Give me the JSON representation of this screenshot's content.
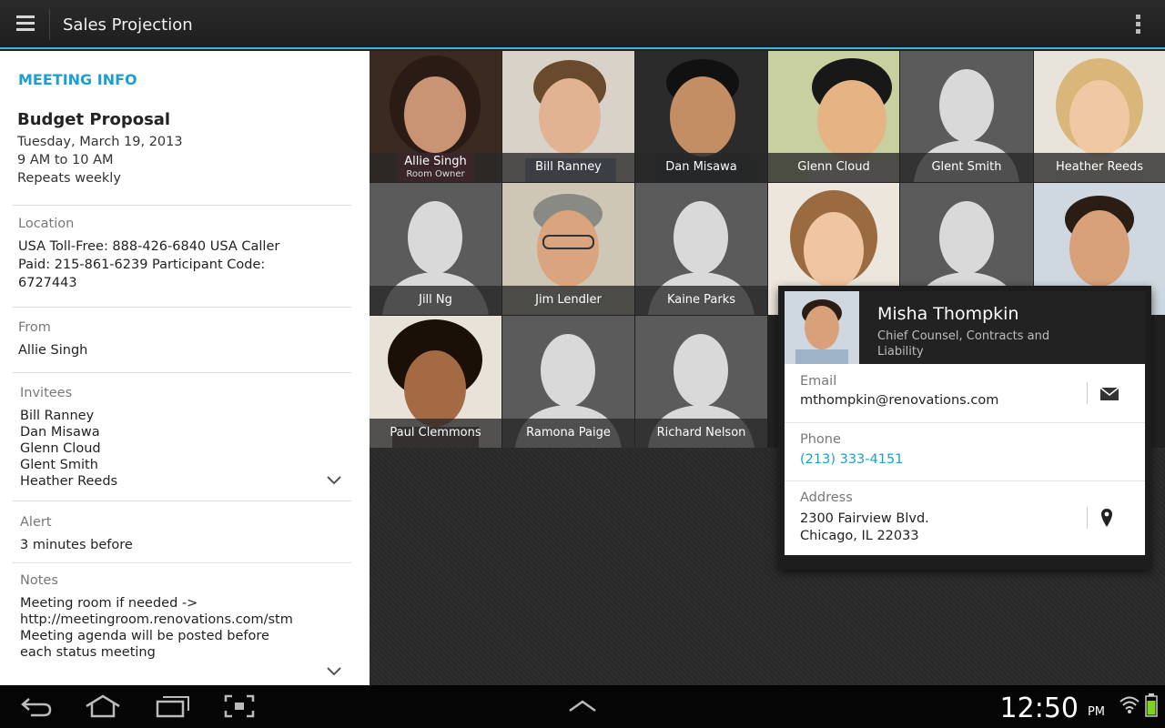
{
  "app": {
    "title": "Sales Projection"
  },
  "meeting": {
    "header": "MEETING INFO",
    "title": "Budget Proposal",
    "date": "Tuesday, March 19, 2013",
    "time": "9 AM to 10 AM",
    "repeat": "Repeats weekly",
    "location_label": "Location",
    "location_value": "USA Toll-Free: 888-426-6840 USA Caller Paid: 215-861-6239 Participant Code: 6727443",
    "from_label": "From",
    "from_value": "Allie Singh",
    "invitees_label": "Invitees",
    "invitees": [
      "Bill Ranney",
      "Dan Misawa",
      "Glenn Cloud",
      "Glent Smith",
      "Heather Reeds"
    ],
    "alert_label": "Alert",
    "alert_value": "3 minutes before",
    "notes_label": "Notes",
    "notes_value": "Meeting room if needed -> http://meetingroom.renovations.com/stmeetings/room/alliesingh@renovations.com/budgetmeetings Meeting agenda will be posted before each status meeting"
  },
  "people": [
    {
      "name": "Allie Singh",
      "sub": "Room Owner"
    },
    {
      "name": "Bill Ranney"
    },
    {
      "name": "Dan Misawa"
    },
    {
      "name": "Glenn Cloud"
    },
    {
      "name": "Glent Smith"
    },
    {
      "name": "Heather Reeds"
    },
    {
      "name": "Jill Ng"
    },
    {
      "name": "Jim Lendler"
    },
    {
      "name": "Kaine Parks"
    },
    {
      "name": ""
    },
    {
      "name": ""
    },
    {
      "name": ""
    },
    {
      "name": "Paul Clemmons"
    },
    {
      "name": "Ramona Paige"
    },
    {
      "name": "Richard Nelson"
    }
  ],
  "contact": {
    "name": "Misha Thompkin",
    "role": "Chief Counsel, Contracts and Liability",
    "email_label": "Email",
    "email": "mthompkin@renovations.com",
    "phone_label": "Phone",
    "phone": "(213) 333-4151",
    "address_label": "Address",
    "address_line1": "2300 Fairview Blvd.",
    "address_line2": "Chicago, IL 22033"
  },
  "status": {
    "time": "12:50",
    "ampm": "PM"
  },
  "colors": {
    "accent": "#33b5e5",
    "link": "#1a9fd0"
  }
}
